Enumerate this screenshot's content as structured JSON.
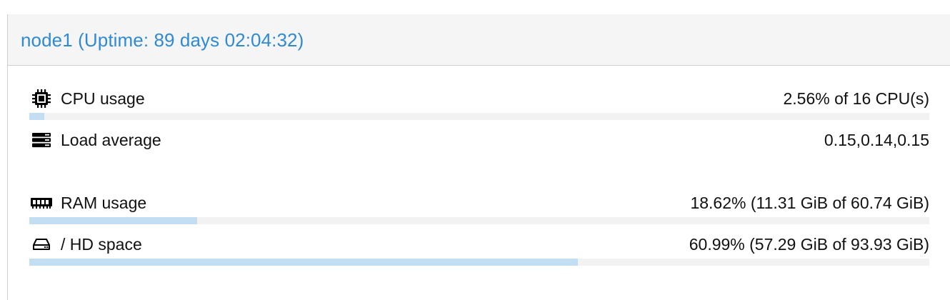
{
  "node": {
    "title": "node1 (Uptime: 89 days 02:04:32)"
  },
  "metrics": {
    "cpu": {
      "label": "CPU usage",
      "value": "2.56% of 16 CPU(s)",
      "icon": "cpu-chip-icon",
      "progress_percent": 1.7
    },
    "load": {
      "label": "Load average",
      "value": "0.15,0.14,0.15",
      "icon": "server-stack-icon"
    },
    "ram": {
      "label": "RAM usage",
      "value": "18.62% (11.31 GiB of 60.74 GiB)",
      "icon": "memory-module-icon",
      "progress_percent": 18.62
    },
    "hd": {
      "label": "/ HD space",
      "value": "60.99% (57.29 GiB of 93.93 GiB)",
      "icon": "hard-drive-icon",
      "progress_percent": 60.99
    }
  },
  "colors": {
    "title": "#2f8ad6",
    "bar_fill": "#c3ddf2",
    "bar_track": "#f2f2f2",
    "header_bg": "#f5f5f5"
  }
}
